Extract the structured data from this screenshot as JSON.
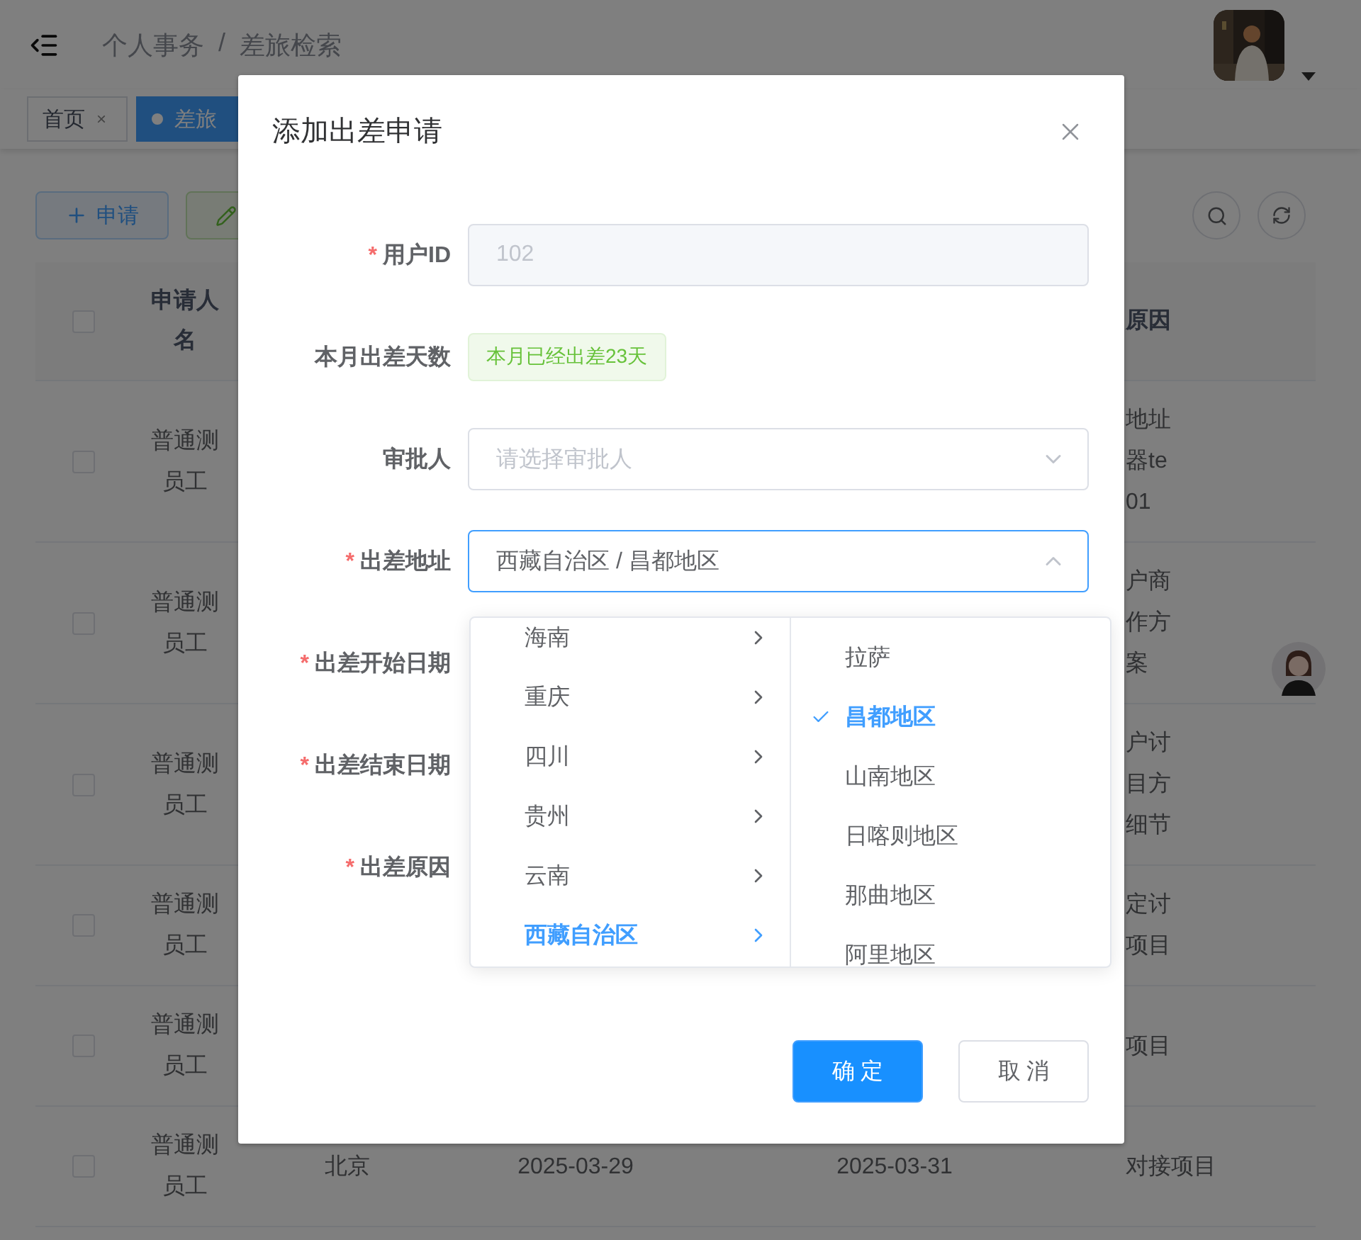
{
  "header": {
    "breadcrumb": [
      "个人事务",
      "差旅检索"
    ],
    "separator": "/"
  },
  "tags": [
    {
      "label": "首页",
      "close": "×",
      "selected": false
    },
    {
      "label": "差旅",
      "selected": true
    }
  ],
  "toolbar": {
    "buttons": [
      {
        "kind": "add",
        "label": "申请"
      },
      {
        "kind": "edit"
      }
    ]
  },
  "table": {
    "header": {
      "checked": false,
      "name_lines": [
        "申请人",
        "名"
      ],
      "reason": "原因"
    },
    "rows": [
      {
        "checked": false,
        "name_lines": [
          "普通测",
          "员工"
        ],
        "reason_lines": [
          "地址",
          "器te",
          "01"
        ]
      },
      {
        "checked": false,
        "name_lines": [
          "普通测",
          "员工"
        ],
        "reason_lines": [
          "户商",
          "作方",
          "案"
        ]
      },
      {
        "checked": false,
        "name_lines": [
          "普通测",
          "员工"
        ],
        "reason_lines": [
          "户讨",
          "目方",
          "细节"
        ]
      },
      {
        "checked": false,
        "name_lines": [
          "普通测",
          "员工"
        ],
        "reason_lines": [
          "定讨",
          "项目"
        ]
      },
      {
        "checked": false,
        "name_lines": [
          "普通测",
          "员工"
        ],
        "reason_lines": [
          "项目"
        ]
      },
      {
        "checked": false,
        "name_lines": [
          "普通测",
          "员工"
        ],
        "city": "北京",
        "start": "2025-03-29",
        "end": "2025-03-31",
        "reason_lines": [
          "对接项目"
        ]
      }
    ]
  },
  "dialog": {
    "title": "添加出差申请",
    "required_mark": "*",
    "fields": [
      {
        "label": "用户ID",
        "required": true,
        "kind": "input",
        "disabled": true,
        "value": "102"
      },
      {
        "label": "本月出差天数",
        "required": false,
        "kind": "tag",
        "value": "本月已经出差23天"
      },
      {
        "label": "审批人",
        "required": false,
        "kind": "select",
        "placeholder": "请选择审批人"
      },
      {
        "label": "出差地址",
        "required": true,
        "kind": "cascader",
        "value": "西藏自治区 / 昌都地区",
        "expanded": true
      },
      {
        "label": "出差开始日期",
        "required": true
      },
      {
        "label": "出差结束日期",
        "required": true
      },
      {
        "label": "出差原因",
        "required": true
      }
    ],
    "cascader": {
      "columns": [
        {
          "items": [
            {
              "label": "海南",
              "selected": false
            },
            {
              "label": "重庆",
              "selected": false
            },
            {
              "label": "四川",
              "selected": false
            },
            {
              "label": "贵州",
              "selected": false
            },
            {
              "label": "云南",
              "selected": false
            },
            {
              "label": "西藏自治区",
              "selected": true
            }
          ]
        },
        {
          "items": [
            {
              "label": "拉萨",
              "selected": false
            },
            {
              "label": "昌都地区",
              "selected": true
            },
            {
              "label": "山南地区",
              "selected": false
            },
            {
              "label": "日喀则地区",
              "selected": false
            },
            {
              "label": "那曲地区",
              "selected": false
            },
            {
              "label": "阿里地区",
              "selected": false
            }
          ]
        }
      ]
    },
    "buttons": [
      {
        "kind": "primary",
        "label": "确 定"
      },
      {
        "kind": "default",
        "label": "取 消"
      }
    ]
  }
}
